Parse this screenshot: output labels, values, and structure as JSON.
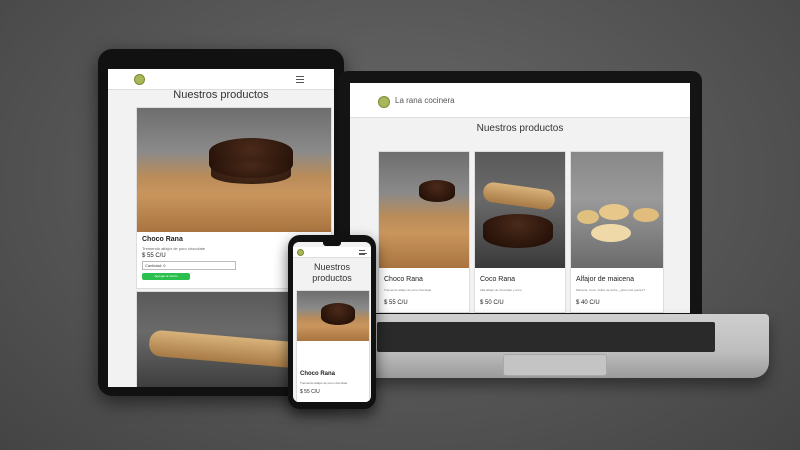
{
  "site": {
    "brand": "La rana cocinera",
    "page_title": "Nuestros productos"
  },
  "products": [
    {
      "name": "Choco Rana",
      "description": "Tremendo alfajor de puro chocolate",
      "price": "$ 55 C/U"
    },
    {
      "name": "Coco Rana",
      "description": "Alfa alfajor de chocolate y coco",
      "price": "$ 50 C/U"
    },
    {
      "name": "Alfajor de maicena",
      "description": "Maicena. Coco. Dulce de leche. ¿Qué más querés?",
      "price": "$ 40 C/U"
    }
  ],
  "tablet_form": {
    "quantity_label": "Cantidad: 0",
    "add_button": "Agregar al carrito"
  },
  "phone": {
    "title_line1": "Nuestros",
    "title_line2": "productos"
  },
  "colors": {
    "accent_green": "#2bbf4d",
    "background": "#555555",
    "logo": "#a7b85a"
  }
}
